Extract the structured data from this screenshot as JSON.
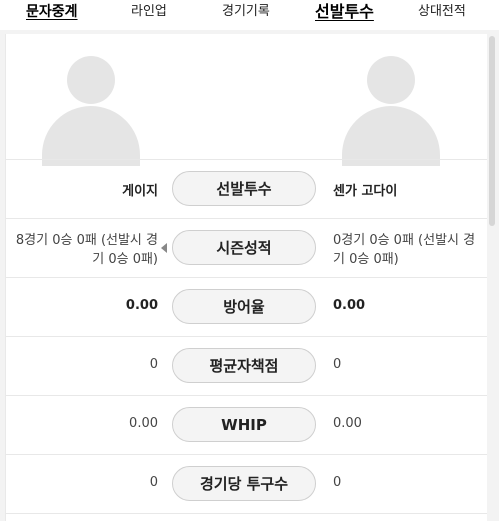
{
  "tabs": [
    {
      "label": "문자중계"
    },
    {
      "label": "라인업"
    },
    {
      "label": "경기기록"
    },
    {
      "label": "선발투수"
    },
    {
      "label": "상대전적"
    }
  ],
  "pitchers": {
    "left_name": "게이지",
    "right_name": "센가 고다이"
  },
  "rows": [
    {
      "label": "선발투수",
      "left": "게이지",
      "right": "센가 고다이"
    },
    {
      "label": "시즌성적",
      "left_line1": "8경기 0승 0패 (선발시 경",
      "left_line2": "기 0승 0패)",
      "right_line1": "0경기 0승 0패 (선발시 경",
      "right_line2": "기 0승 0패)"
    },
    {
      "label": "방어율",
      "left": "0.00",
      "right": "0.00"
    },
    {
      "label": "평균자책점",
      "left": "0",
      "right": "0"
    },
    {
      "label": "WHIP",
      "left": "0.00",
      "right": "0.00"
    },
    {
      "label": "경기당 투구수",
      "left": "0",
      "right": "0"
    }
  ],
  "icons": {
    "avatar_left": "user-silhouette-icon",
    "avatar_right": "user-silhouette-icon",
    "expand_arrow": "triangle-left-icon"
  }
}
